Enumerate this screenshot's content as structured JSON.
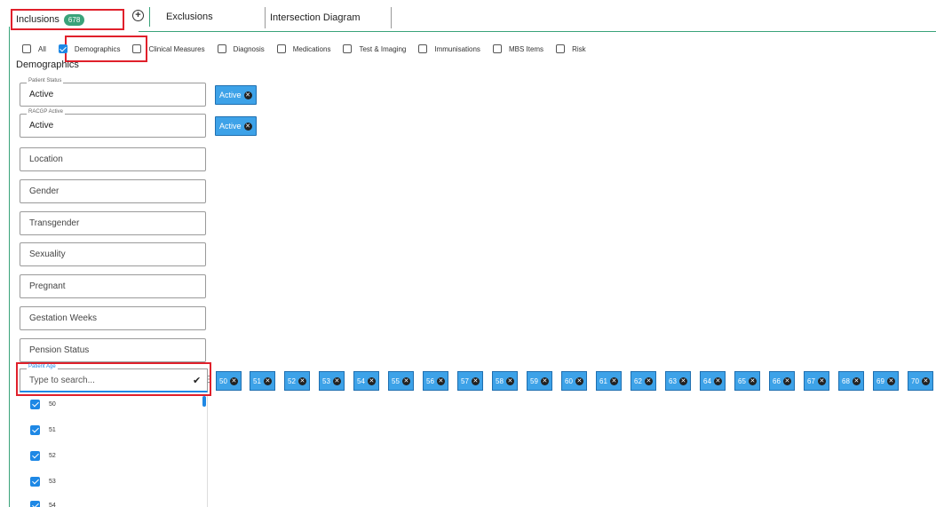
{
  "tabs": {
    "inclusions_label": "Inclusions",
    "inclusions_count": "678",
    "exclusions_label": "Exclusions",
    "intersection_label": "Intersection Diagram"
  },
  "categories": [
    {
      "label": "All",
      "checked": false
    },
    {
      "label": "Demographics",
      "checked": true
    },
    {
      "label": "Clinical Measures",
      "checked": false
    },
    {
      "label": "Diagnosis",
      "checked": false
    },
    {
      "label": "Medications",
      "checked": false
    },
    {
      "label": "Test & Imaging",
      "checked": false
    },
    {
      "label": "Immunisations",
      "checked": false
    },
    {
      "label": "MBS Items",
      "checked": false
    },
    {
      "label": "Risk",
      "checked": false
    }
  ],
  "section_title": "Demographics",
  "fields": {
    "patient_status": {
      "label": "Patient Status",
      "value": "Active",
      "chip": "Active"
    },
    "racgp_active": {
      "label": "RACGP Active",
      "value": "Active",
      "chip": "Active"
    },
    "location": "Location",
    "gender": "Gender",
    "transgender": "Transgender",
    "sexuality": "Sexuality",
    "pregnant": "Pregnant",
    "gestation_weeks": "Gestation Weeks",
    "pension_status": "Pension Status"
  },
  "patient_age": {
    "label": "Patient Age",
    "placeholder": "Type to search...",
    "chips": [
      "50",
      "51",
      "52",
      "53",
      "54",
      "55",
      "56",
      "57",
      "58",
      "59",
      "60",
      "61",
      "62",
      "63",
      "64",
      "65",
      "66",
      "67",
      "68",
      "69",
      "70"
    ],
    "options": [
      "50",
      "51",
      "52",
      "53",
      "54"
    ]
  },
  "colors": {
    "accent": "#1e88e5",
    "chip": "#3da2e8",
    "highlight": "#e0202b",
    "tab_green": "#3aa37a"
  }
}
